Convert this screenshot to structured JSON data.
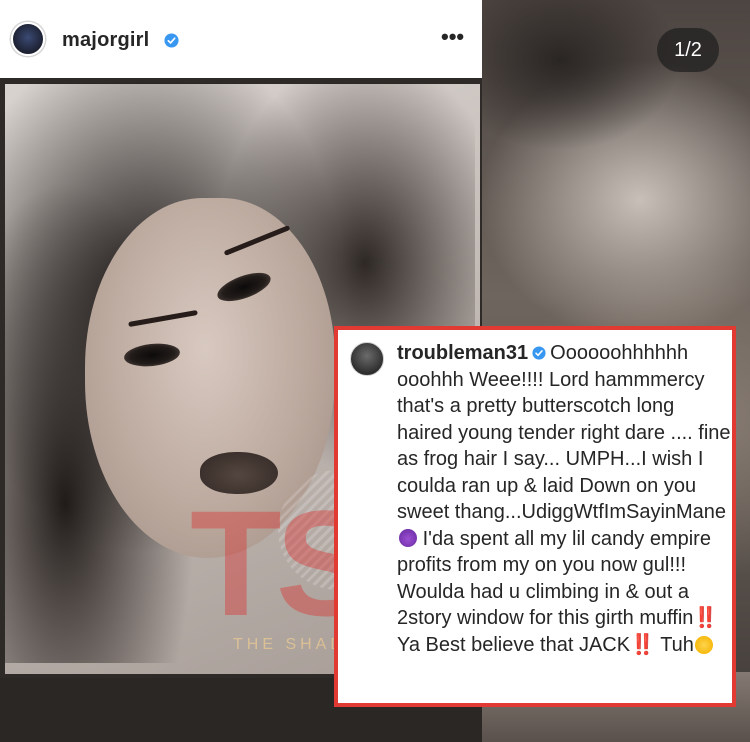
{
  "post": {
    "username": "majorgirl",
    "more_label": "•••",
    "page_indicator": "1/2",
    "watermark_letters": "TSR",
    "watermark_text": "THE SHADE ROOM"
  },
  "comment": {
    "username": "troubleman31",
    "text_part1": "Oooooohhhhhh ooohhh Weee!!!! Lord hammmercy that's a pretty butterscotch long haired young tender right dare .... fine as frog hair I say... UMPH...I wish I coulda ran up & laid Down on you sweet thang...UdiggWtfImSayinMane",
    "text_part2": "I'da spent all my lil candy empire profits from my on you now gul!!! Woulda had u climbing in & out a 2story window for this girth muffin",
    "double_bang": "‼️",
    "text_part3": " Ya Best believe that JACK",
    "text_part4": " Tuh"
  },
  "colors": {
    "highlight_border": "#e03a32",
    "verified_blue": "#3897f0"
  },
  "icons": [
    "verified-badge-icon",
    "more-options-icon",
    "devil-emoji-icon",
    "angry-emoji-icon"
  ]
}
